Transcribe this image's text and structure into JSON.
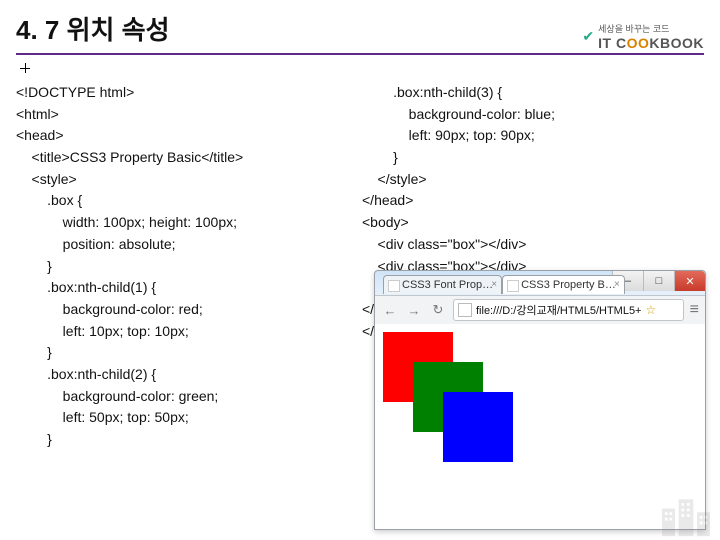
{
  "header": {
    "title": "4. 7 위치 속성",
    "logo_small": "세상을 바꾸는 코드",
    "logo_main_a": "IT C",
    "logo_main_b": "OO",
    "logo_main_c": "KBOOK"
  },
  "code_left": "<!DOCTYPE html>\n<html>\n<head>\n    <title>CSS3 Property Basic</title>\n    <style>\n        .box {\n            width: 100px; height: 100px;\n            position: absolute;\n        }\n        .box:nth-child(1) {\n            background-color: red;\n            left: 10px; top: 10px;\n        }\n        .box:nth-child(2) {\n            background-color: green;\n            left: 50px; top: 50px;\n        }",
  "code_right": "        .box:nth-child(3) {\n            background-color: blue;\n            left: 90px; top: 90px;\n        }\n    </style>\n</head>\n<body>\n    <div class=\"box\"></div>\n    <div class=\"box\"></div>\n    <div class=\"box\"></div>\n</body>\n</html>",
  "browser": {
    "tab_inactive": "CSS3 Font Prop…",
    "tab_active": "CSS3 Property B…",
    "url_prefix": "file:///D:/강의교재/HTML5/HTML5+ ",
    "win_min": "–",
    "win_max": "□",
    "win_close": "✕",
    "back": "←",
    "forward": "→",
    "reload": "↻",
    "tab_close": "×",
    "star": "☆",
    "menu": "≡"
  }
}
